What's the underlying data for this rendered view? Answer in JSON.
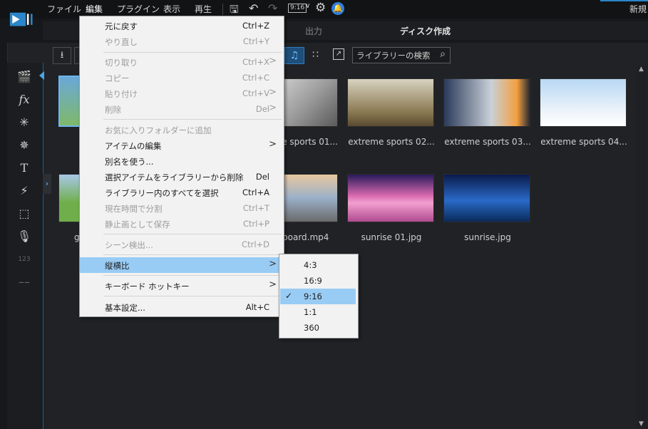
{
  "menubar": {
    "items": [
      "ファイル",
      "編集",
      "プラグイン",
      "表示",
      "再生"
    ],
    "aspect_badge": "9:16",
    "right_label": "新規"
  },
  "tabs": {
    "output": "出力",
    "disc": "ディスク作成"
  },
  "toolbar": {
    "search_placeholder": "ライブラリーの検索"
  },
  "library": {
    "row1": [
      {
        "label": "e sports 01...",
        "thumb": "sports-bmx"
      },
      {
        "label": "extreme sports 02...",
        "thumb": "sports-moto"
      },
      {
        "label": "extreme sports 03...",
        "thumb": "sports-skate"
      },
      {
        "label": "extreme sports 04...",
        "thumb": "sports-sky"
      }
    ],
    "row2": [
      {
        "label": "g",
        "thumb": "grass"
      },
      {
        "label": "board.mp4",
        "thumb": "skateboard"
      },
      {
        "label": "sunrise 01.jpg",
        "thumb": "sunrise1"
      },
      {
        "label": "sunrise.jpg",
        "thumb": "sunrise2"
      }
    ]
  },
  "context_menu": {
    "items": [
      {
        "label": "元に戻す",
        "shortcut": "Ctrl+Z",
        "disabled": false
      },
      {
        "label": "やり直し",
        "shortcut": "Ctrl+Y",
        "disabled": true
      },
      {
        "label": "切り取り",
        "shortcut": "Ctrl+X",
        "disabled": true
      },
      {
        "label": "コピー",
        "shortcut": "Ctrl+C",
        "disabled": true
      },
      {
        "label": "貼り付け",
        "shortcut": "Ctrl+V",
        "disabled": true
      },
      {
        "label": "削除",
        "shortcut": "Del",
        "disabled": true
      },
      {
        "label": "お気に入りフォルダーに追加",
        "shortcut": "",
        "disabled": true
      },
      {
        "label": "アイテムの編集",
        "shortcut": "",
        "disabled": false
      },
      {
        "label": "別名を使う...",
        "shortcut": "",
        "disabled": false
      },
      {
        "label": "選択アイテムをライブラリーから削除",
        "shortcut": "Del",
        "disabled": false
      },
      {
        "label": "ライブラリー内のすべてを選択",
        "shortcut": "Ctrl+A",
        "disabled": false
      },
      {
        "label": "現在時間で分割",
        "shortcut": "Ctrl+T",
        "disabled": true
      },
      {
        "label": "静止画として保存",
        "shortcut": "Ctrl+P",
        "disabled": true
      },
      {
        "label": "シーン検出...",
        "shortcut": "Ctrl+D",
        "disabled": true
      },
      {
        "label": "縦横比",
        "shortcut": "",
        "disabled": false
      },
      {
        "label": "キーボード ホットキー",
        "shortcut": "",
        "disabled": false
      },
      {
        "label": "基本設定...",
        "shortcut": "Alt+C",
        "disabled": false
      }
    ],
    "submenu_arrow": ">"
  },
  "aspect_submenu": {
    "items": [
      "4:3",
      "16:9",
      "9:16",
      "1:1",
      "360"
    ],
    "selected": "9:16"
  }
}
